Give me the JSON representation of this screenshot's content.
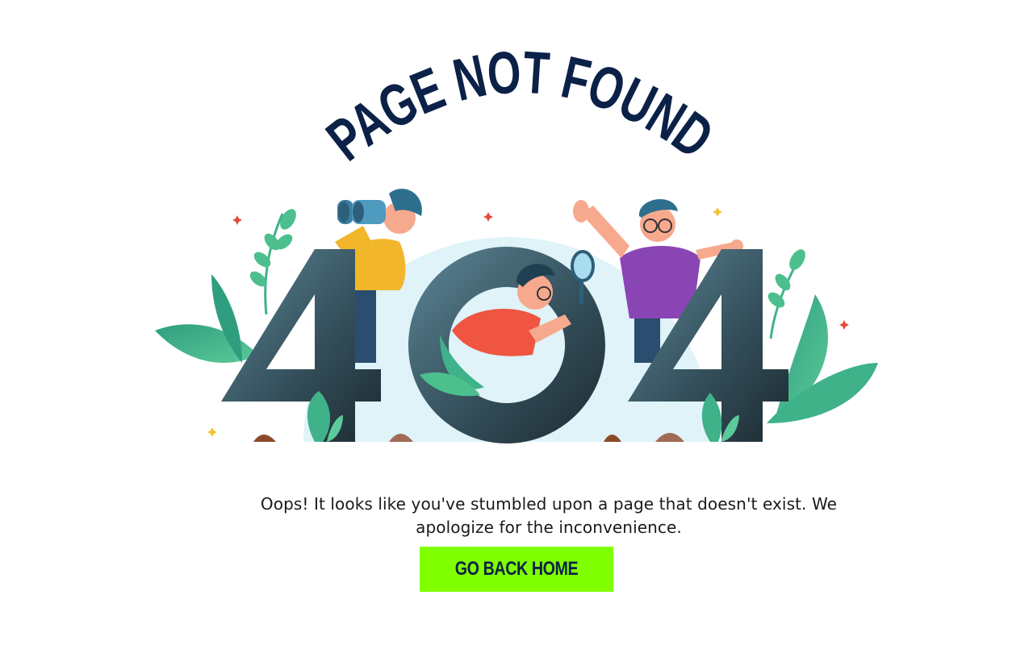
{
  "hero": {
    "title": "PAGE NOT FOUND",
    "error_code": "404"
  },
  "message": "Oops! It looks like you've stumbled upon a page that doesn't exist. We apologize for the inconvenience.",
  "cta": {
    "label": "GO BACK HOME"
  },
  "colors": {
    "title": "#0b2147",
    "digits_dark": "#1f2e36",
    "digits_light": "#5d8696",
    "backdrop": "#dff3f8",
    "leaf": "#3fb28a",
    "button_bg": "#7fff00",
    "button_text": "#0b2147"
  },
  "icons": {
    "binoculars": "binoculars-icon",
    "magnifier": "magnifying-glass-icon"
  }
}
